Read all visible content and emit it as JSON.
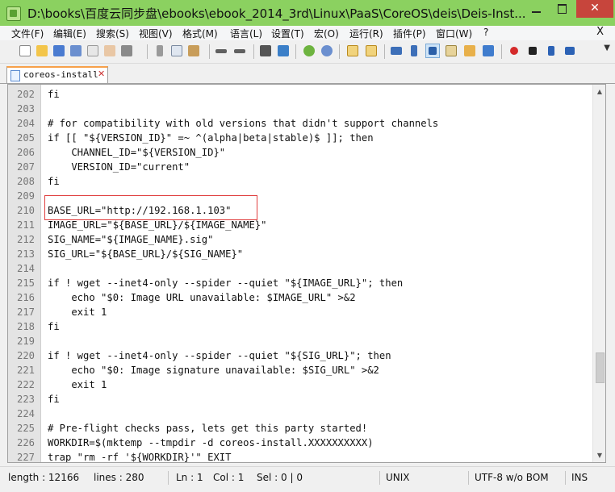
{
  "window": {
    "title": "D:\\books\\百度云同步盘\\ebooks\\ebook_2014_3rd\\Linux\\PaaS\\CoreOS\\deis\\Deis-Inst...",
    "close_glyph": "✕"
  },
  "menu": {
    "items": [
      "文件(F)",
      "编辑(E)",
      "搜索(S)",
      "视图(V)",
      "格式(M)",
      "语言(L)",
      "设置(T)",
      "宏(O)",
      "运行(R)",
      "插件(P)",
      "窗口(W)",
      "?"
    ],
    "close": "X"
  },
  "toolbar": {
    "icons": [
      "new-file-icon",
      "open-file-icon",
      "save-icon",
      "save-all-icon",
      "close-icon",
      "close-all-icon",
      "print-icon",
      "cut-icon",
      "copy-icon",
      "paste-icon",
      "undo-icon",
      "redo-icon",
      "find-icon",
      "replace-icon",
      "zoom-in-icon",
      "zoom-out-icon",
      "sync-vertical-icon",
      "sync-horizontal-icon",
      "word-wrap-icon",
      "show-all-chars-icon",
      "indent-guide-icon",
      "document-map-icon",
      "function-list-icon",
      "folder-workspace-icon",
      "record-macro-icon",
      "stop-macro-icon",
      "play-macro-icon",
      "run-macro-multiple-icon"
    ],
    "more": "▼"
  },
  "tab": {
    "label": "coreos-install",
    "close": "✕"
  },
  "editor": {
    "lines": [
      {
        "no": "202",
        "code": "fi"
      },
      {
        "no": "203",
        "code": ""
      },
      {
        "no": "204",
        "code": "# for compatibility with old versions that didn't support channels"
      },
      {
        "no": "205",
        "code": "if [[ \"${VERSION_ID}\" =~ ^(alpha|beta|stable)$ ]]; then"
      },
      {
        "no": "206",
        "code": "    CHANNEL_ID=\"${VERSION_ID}\""
      },
      {
        "no": "207",
        "code": "    VERSION_ID=\"current\""
      },
      {
        "no": "208",
        "code": "fi"
      },
      {
        "no": "209",
        "code": ""
      },
      {
        "no": "210",
        "code": "BASE_URL=\"http://192.168.1.103\""
      },
      {
        "no": "211",
        "code": "IMAGE_URL=\"${BASE_URL}/${IMAGE_NAME}\""
      },
      {
        "no": "212",
        "code": "SIG_NAME=\"${IMAGE_NAME}.sig\""
      },
      {
        "no": "213",
        "code": "SIG_URL=\"${BASE_URL}/${SIG_NAME}\""
      },
      {
        "no": "214",
        "code": ""
      },
      {
        "no": "215",
        "code": "if ! wget --inet4-only --spider --quiet \"${IMAGE_URL}\"; then"
      },
      {
        "no": "216",
        "code": "    echo \"$0: Image URL unavailable: $IMAGE_URL\" >&2"
      },
      {
        "no": "217",
        "code": "    exit 1"
      },
      {
        "no": "218",
        "code": "fi"
      },
      {
        "no": "219",
        "code": ""
      },
      {
        "no": "220",
        "code": "if ! wget --inet4-only --spider --quiet \"${SIG_URL}\"; then"
      },
      {
        "no": "221",
        "code": "    echo \"$0: Image signature unavailable: $SIG_URL\" >&2"
      },
      {
        "no": "222",
        "code": "    exit 1"
      },
      {
        "no": "223",
        "code": "fi"
      },
      {
        "no": "224",
        "code": ""
      },
      {
        "no": "225",
        "code": "# Pre-flight checks pass, lets get this party started!"
      },
      {
        "no": "226",
        "code": "WORKDIR=$(mktemp --tmpdir -d coreos-install.XXXXXXXXXX)"
      },
      {
        "no": "227",
        "code": "trap \"rm -rf '${WORKDIR}'\" EXIT"
      }
    ]
  },
  "status": {
    "length": "length : 12166",
    "lines": "lines : 280",
    "ln": "Ln : 1",
    "col": "Col : 1",
    "sel": "Sel : 0 | 0",
    "eol": "UNIX",
    "encoding": "UTF-8 w/o BOM",
    "mode": "INS"
  },
  "colors": {
    "titlebar": "#8bd160",
    "close_button": "#c7453c",
    "highlight_box": "#e04040",
    "tab_accent": "#f7a14a"
  }
}
